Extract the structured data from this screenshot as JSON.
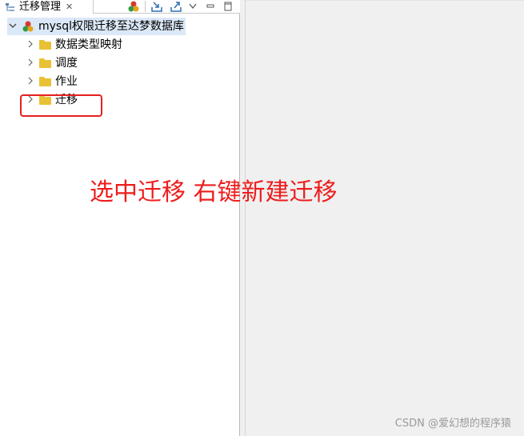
{
  "panel": {
    "tab_title": "迁移管理",
    "tab_close": "✕"
  },
  "toolbar": {
    "icons": [
      "db-connect-icon",
      "import-icon",
      "export-icon",
      "view-menu-icon",
      "minimize-icon",
      "maximize-icon"
    ]
  },
  "tree": {
    "root_label": "mysql权限迁移至达梦数据库",
    "root_expanded": "expanded",
    "children": [
      {
        "label": "数据类型映射"
      },
      {
        "label": "调度"
      },
      {
        "label": "作业"
      },
      {
        "label": "迁移"
      }
    ]
  },
  "annotation": {
    "text": "选中迁移 右键新建迁移"
  },
  "watermark": {
    "text": "CSDN @爱幻想的程序猿"
  },
  "colors": {
    "highlight": "#e62020",
    "annotation": "#ee1c1c",
    "folder": "#e8c234",
    "selection": "#dbe8f7"
  }
}
